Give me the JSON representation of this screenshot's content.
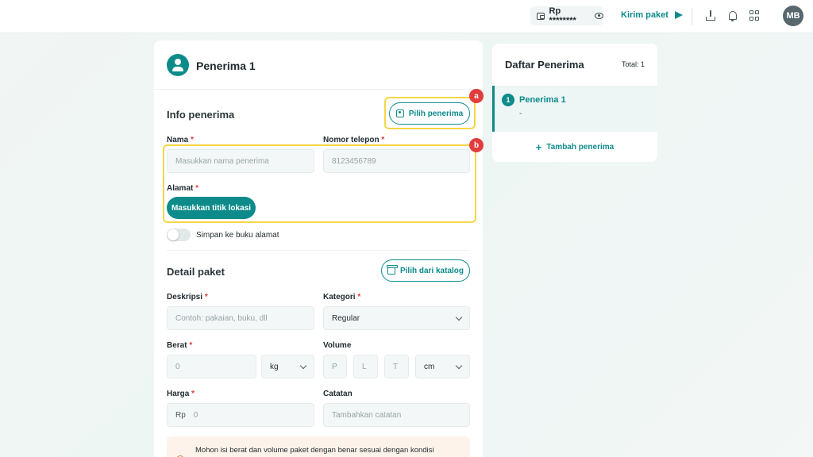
{
  "topbar": {
    "balance": "Rp ********",
    "send_label": "Kirim paket",
    "avatar_initials": "MB"
  },
  "recipient_card": {
    "title": "Penerima 1",
    "info_section": {
      "title": "Info penerima",
      "choose_button": "Pilih penerima",
      "name_label": "Nama",
      "name_placeholder": "Masukkan nama penerima",
      "phone_label": "Nomor telepon",
      "phone_value": "8123456789",
      "address_label": "Alamat",
      "location_button": "Masukkan titik lokasi",
      "save_toggle_label": "Simpan ke buku alamat",
      "required_mark": "*"
    },
    "package_section": {
      "title": "Detail paket",
      "catalog_button": "Pilih dari katalog",
      "description_label": "Deskripsi",
      "description_placeholder": "Contoh: pakaian, buku, dll",
      "category_label": "Kategori",
      "category_value": "Regular",
      "weight_label": "Berat",
      "weight_placeholder": "0",
      "weight_unit": "kg",
      "volume_label": "Volume",
      "volume_p": "P",
      "volume_l": "L",
      "volume_t": "T",
      "volume_unit": "cm",
      "price_label": "Harga",
      "price_prefix": "Rp",
      "price_placeholder": "0",
      "notes_label": "Catatan",
      "notes_placeholder": "Tambahkan catatan"
    },
    "notice": "Mohon isi berat dan volume paket dengan benar sesuai dengan kondisi"
  },
  "annotations": {
    "a": "a",
    "b": "b",
    "highlight_color": "#f5d648",
    "badge_color": "#e23d3d"
  },
  "recipient_list": {
    "title": "Daftar Penerima",
    "total": "Total: 1",
    "items": [
      {
        "number": "1",
        "name": "Penerima 1",
        "sub": "-"
      }
    ],
    "add_label": "Tambah penerima"
  },
  "colors": {
    "accent": "#0d8b8b",
    "required": "#e03a3a"
  }
}
